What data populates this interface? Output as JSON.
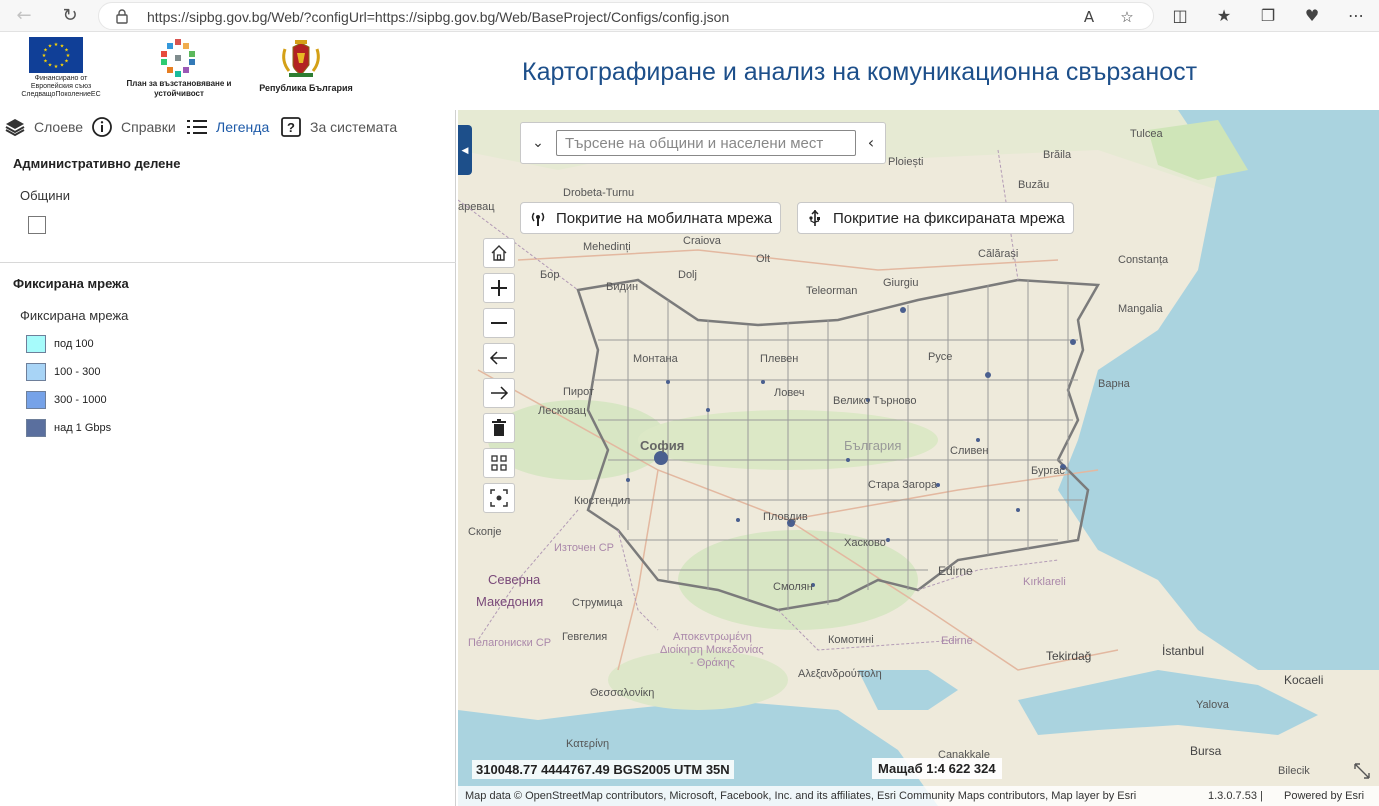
{
  "browser": {
    "url": "https://sipbg.gov.bg/Web/?configUrl=https://sipbg.gov.bg/Web/BaseProject/Configs/config.json",
    "back_icon": "back-arrow-icon",
    "reload_icon": "reload-icon"
  },
  "header": {
    "title": "Картографиране и анализ на комуникационна свързаност",
    "logos": [
      {
        "caption": "Финансирано от Европейския съюз СледващоПоколениеЕС"
      },
      {
        "caption": "План за възстановяване и устойчивост"
      },
      {
        "caption": "Република България"
      }
    ]
  },
  "panel": {
    "tabs": [
      {
        "label": "Слоеве",
        "icon": "layers-icon"
      },
      {
        "label": "Справки",
        "icon": "info-icon"
      },
      {
        "label": "Легенда",
        "icon": "legend-list-icon",
        "active": true
      },
      {
        "label": "За системата",
        "icon": "help-icon"
      }
    ],
    "sections": [
      {
        "title": "Административно делене",
        "sublabel": "Общини"
      },
      {
        "title": "Фиксирана мрежа",
        "sublabel": "Фиксирана мрежа"
      }
    ],
    "legend": [
      {
        "label": "под 100",
        "color": "#a6fbfb"
      },
      {
        "label": "100 - 300",
        "color": "#a8d4f6"
      },
      {
        "label": "300 - 1000",
        "color": "#76a2e8"
      },
      {
        "label": "над 1 Gbps",
        "color": "#5a6f9e"
      }
    ]
  },
  "map": {
    "search_placeholder": "Търсене на общини и населени мест",
    "coverage_buttons": [
      {
        "label": "Покритие на мобилната мрежа",
        "icon": "antenna-icon"
      },
      {
        "label": "Покритие на фиксираната мрежа",
        "icon": "cable-icon"
      }
    ],
    "tools": [
      "home-icon",
      "zoom-in-icon",
      "zoom-out-icon",
      "prev-extent-icon",
      "next-extent-icon",
      "trash-icon",
      "qr-select-icon",
      "focus-select-icon"
    ],
    "coordinates": "310048.77 4444767.49 BGS2005 UTM 35N",
    "scale": "Мащаб 1:4 622 324",
    "attribution": "Map data © OpenStreetMap contributors, Microsoft, Facebook, Inc. and its affiliates, Esri Community Maps contributors, Map layer by Esri",
    "version": "1.3.0.7.53 |",
    "powered": "Powered by Esri",
    "place_labels": [
      {
        "text": "Tulcea"
      },
      {
        "text": "Ploiești"
      },
      {
        "text": "Brăila"
      },
      {
        "text": "Buzău"
      },
      {
        "text": "Drobeta-Turnu"
      },
      {
        "text": "Craiova"
      },
      {
        "text": "Mehedinți"
      },
      {
        "text": "Dolj"
      },
      {
        "text": "Olt"
      },
      {
        "text": "Teleorman"
      },
      {
        "text": "Giurgiu"
      },
      {
        "text": "Călărași"
      },
      {
        "text": "Constanța"
      },
      {
        "text": "Mangalia"
      },
      {
        "text": "Бор"
      },
      {
        "text": "Видин"
      },
      {
        "text": "Монтана"
      },
      {
        "text": "Плевен"
      },
      {
        "text": "Русе"
      },
      {
        "text": "Варна"
      },
      {
        "text": "Пирот"
      },
      {
        "text": "Ловеч"
      },
      {
        "text": "Велико Търново"
      },
      {
        "text": "Лесковац"
      },
      {
        "text": "София"
      },
      {
        "text": "България"
      },
      {
        "text": "Сливен"
      },
      {
        "text": "Бургас"
      },
      {
        "text": "Стара Загора"
      },
      {
        "text": "Кюстендил"
      },
      {
        "text": "Пловдив"
      },
      {
        "text": "Хасково"
      },
      {
        "text": "Скопје"
      },
      {
        "text": "Източен СР"
      },
      {
        "text": "Смолян"
      },
      {
        "text": "Edirne"
      },
      {
        "text": "Kırklareli"
      },
      {
        "text": "Северна"
      },
      {
        "text": "Македония"
      },
      {
        "text": "Струмица"
      },
      {
        "text": "Комотині"
      },
      {
        "text": "Гевгелия"
      },
      {
        "text": "Αποκεντρωμένη"
      },
      {
        "text": "Διοίκηση Μακεδονίας"
      },
      {
        "text": "- Θράκης"
      },
      {
        "text": "Пелагониски СР"
      },
      {
        "text": "Tekirdağ"
      },
      {
        "text": "İstanbul"
      },
      {
        "text": "Kocaeli"
      },
      {
        "text": "Αλεξανδρούπολη"
      },
      {
        "text": "Θεσσαλονίκη"
      },
      {
        "text": "Yalova"
      },
      {
        "text": "Bursa"
      },
      {
        "text": "Çanakkale"
      },
      {
        "text": "Bilecik"
      },
      {
        "text": "Κατερίνη"
      },
      {
        "text": "Edirne"
      },
      {
        "text": "аревац"
      }
    ]
  }
}
